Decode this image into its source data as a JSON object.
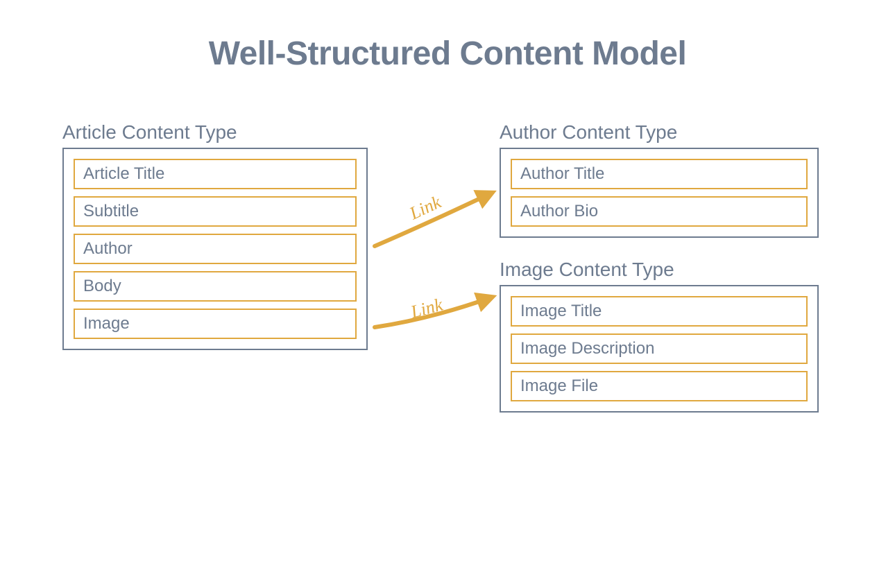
{
  "title": "Well-Structured Content Model",
  "article": {
    "label": "Article Content Type",
    "fields": [
      "Article Title",
      "Subtitle",
      "Author",
      "Body",
      "Image"
    ]
  },
  "author": {
    "label": "Author Content Type",
    "fields": [
      "Author Title",
      "Author Bio"
    ]
  },
  "image": {
    "label": "Image Content Type",
    "fields": [
      "Image Title",
      "Image Description",
      "Image File"
    ]
  },
  "links": {
    "link1_label": "Link",
    "link2_label": "Link"
  },
  "colors": {
    "text_blue_gray": "#6d7b8f",
    "accent_gold": "#e0a83f"
  }
}
